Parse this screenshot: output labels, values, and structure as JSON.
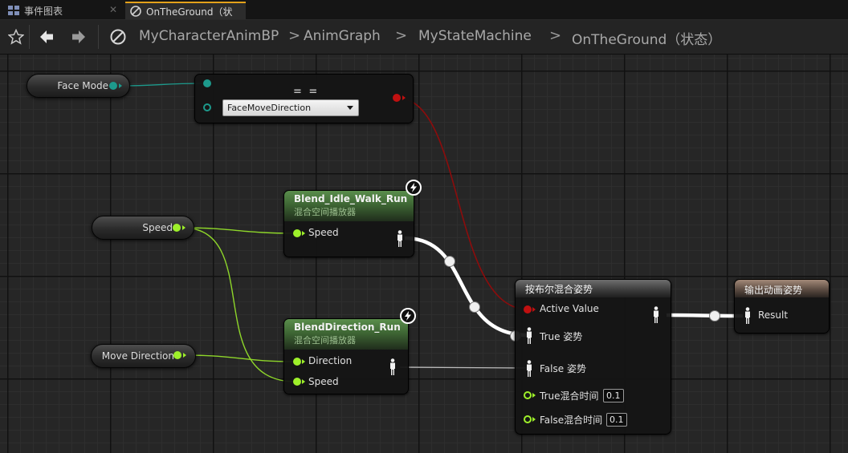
{
  "tabs": [
    {
      "label": "事件图表",
      "icon": "event-graph-icon",
      "active": false
    },
    {
      "label": "OnTheGround（状",
      "icon": "state-icon",
      "active": true
    }
  ],
  "toolbar": {
    "breadcrumbs": [
      "MyCharacterAnimBP",
      "AnimGraph",
      "MyStateMachine",
      "OnTheGround（状态）"
    ],
    "separator": ">"
  },
  "graph": {
    "face_mode_var": {
      "label": "Face Mode"
    },
    "enum_node": {
      "selected": "FaceMoveDirection",
      "title_marks": "= ="
    },
    "speed_var": {
      "label": "Speed"
    },
    "move_direction_var": {
      "label": "Move Direction"
    },
    "blend_idle": {
      "title": "Blend_Idle_Walk_Run",
      "subtitle": "混合空间播放器",
      "pin_speed": "Speed"
    },
    "blend_direction": {
      "title": "BlendDirection_Run",
      "subtitle": "混合空间播放器",
      "pin_direction": "Direction",
      "pin_speed": "Speed"
    },
    "blend_bool": {
      "title": "按布尔混合姿势",
      "pin_active": "Active Value",
      "pin_true_pose": "True 姿势",
      "pin_false_pose": "False 姿势",
      "pin_true_time": "True混合时间",
      "true_time_value": "0.1",
      "pin_false_time": "False混合时间",
      "false_time_value": "0.1"
    },
    "output_pose": {
      "title": "输出动画姿势",
      "pin_result": "Result"
    }
  },
  "colors": {
    "accent_tab": "#e3a11a",
    "float_pin": "#9ef02a",
    "enum_pin": "#1d9a8c",
    "bool_pin": "#c01010",
    "pose_wire": "#ffffff",
    "node_green": "#3e6634"
  }
}
